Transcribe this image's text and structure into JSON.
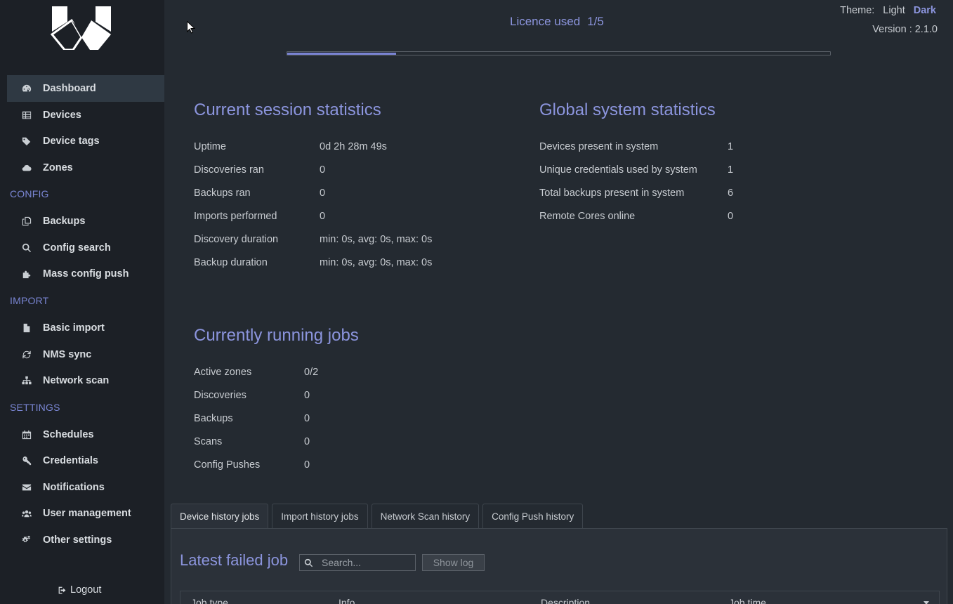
{
  "sidebar": {
    "logo": "logo-icon",
    "items": [
      {
        "label": "Dashboard",
        "icon": "dashboard-icon"
      },
      {
        "label": "Devices",
        "icon": "table-icon"
      },
      {
        "label": "Device tags",
        "icon": "tags-icon"
      },
      {
        "label": "Zones",
        "icon": "cloud-icon"
      },
      {
        "label": "Backups",
        "icon": "copy-icon"
      },
      {
        "label": "Config search",
        "icon": "search-icon"
      },
      {
        "label": "Mass config push",
        "icon": "puzzle-icon"
      },
      {
        "label": "Basic import",
        "icon": "file-icon"
      },
      {
        "label": "NMS sync",
        "icon": "refresh-icon"
      },
      {
        "label": "Network scan",
        "icon": "sitemap-icon"
      },
      {
        "label": "Schedules",
        "icon": "calendar-icon"
      },
      {
        "label": "Credentials",
        "icon": "key-icon"
      },
      {
        "label": "Notifications",
        "icon": "envelope-icon"
      },
      {
        "label": "User management",
        "icon": "users-icon"
      },
      {
        "label": "Other settings",
        "icon": "gears-icon"
      }
    ],
    "sections": {
      "config": "CONFIG",
      "import": "IMPORT",
      "settings": "SETTINGS"
    },
    "logout": "Logout"
  },
  "header": {
    "licence_label": "Licence used",
    "licence_value": "1/5",
    "licence_fraction": 0.2,
    "theme_label": "Theme:",
    "theme_light": "Light",
    "theme_dark": "Dark",
    "version": "Version : 2.1.0"
  },
  "session": {
    "title": "Current session statistics",
    "rows": [
      {
        "label": "Uptime",
        "value": "0d 2h 28m 49s"
      },
      {
        "label": "Discoveries ran",
        "value": "0"
      },
      {
        "label": "Backups ran",
        "value": "0"
      },
      {
        "label": "Imports performed",
        "value": "0"
      },
      {
        "label": "Discovery duration",
        "value": "min: 0s, avg: 0s, max: 0s"
      },
      {
        "label": "Backup duration",
        "value": "min: 0s, avg: 0s, max: 0s"
      }
    ]
  },
  "global": {
    "title": "Global system statistics",
    "rows": [
      {
        "label": "Devices present in system",
        "value": "1"
      },
      {
        "label": "Unique credentials used by system",
        "value": "1"
      },
      {
        "label": "Total backups present in system",
        "value": "6"
      },
      {
        "label": "Remote Cores online",
        "value": "0"
      }
    ]
  },
  "jobs": {
    "title": "Currently running jobs",
    "rows": [
      {
        "label": "Active zones",
        "value": "0/2"
      },
      {
        "label": "Discoveries",
        "value": "0"
      },
      {
        "label": "Backups",
        "value": "0"
      },
      {
        "label": "Scans",
        "value": "0"
      },
      {
        "label": "Config Pushes",
        "value": "0"
      }
    ]
  },
  "history": {
    "tabs": [
      "Device history jobs",
      "Import history jobs",
      "Network Scan history",
      "Config Push history"
    ],
    "panel_title": "Latest failed job",
    "search_placeholder": "Search...",
    "show_log": "Show log",
    "columns": [
      "Job type",
      "Info",
      "Description",
      "Job time"
    ]
  },
  "colors": {
    "accent": "#8c95de",
    "sidebar": "#1c2026",
    "background": "#242a31"
  }
}
